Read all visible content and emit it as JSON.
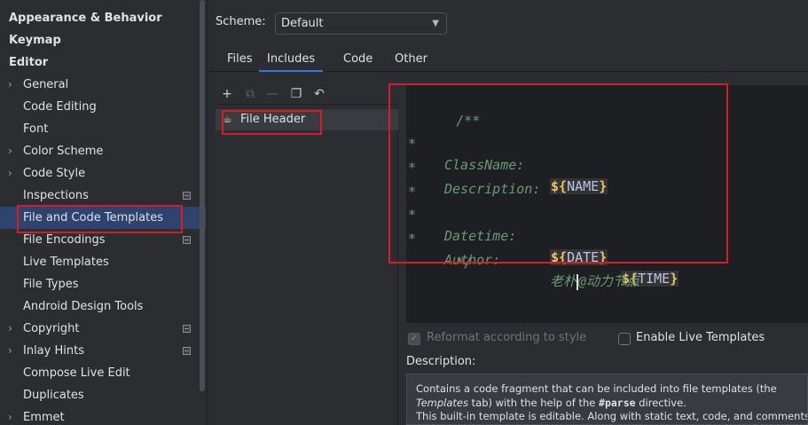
{
  "sidebar": {
    "items": [
      {
        "label": "Appearance & Behavior",
        "level": "top"
      },
      {
        "label": "Keymap",
        "level": "top"
      },
      {
        "label": "Editor",
        "level": "top"
      },
      {
        "label": "General",
        "level": "child",
        "arrow": "›"
      },
      {
        "label": "Code Editing",
        "level": "child"
      },
      {
        "label": "Font",
        "level": "child"
      },
      {
        "label": "Color Scheme",
        "level": "child",
        "arrow": "›"
      },
      {
        "label": "Code Style",
        "level": "child",
        "arrow": "›"
      },
      {
        "label": "Inspections",
        "level": "child",
        "badge": true
      },
      {
        "label": "File and Code Templates",
        "level": "child",
        "selected": true
      },
      {
        "label": "File Encodings",
        "level": "child",
        "badge": true
      },
      {
        "label": "Live Templates",
        "level": "child"
      },
      {
        "label": "File Types",
        "level": "child"
      },
      {
        "label": "Android Design Tools",
        "level": "child"
      },
      {
        "label": "Copyright",
        "level": "child",
        "arrow": "›",
        "badge": true
      },
      {
        "label": "Inlay Hints",
        "level": "child",
        "arrow": "›",
        "badge": true
      },
      {
        "label": "Compose Live Edit",
        "level": "child"
      },
      {
        "label": "Duplicates",
        "level": "child"
      },
      {
        "label": "Emmet",
        "level": "child",
        "arrow": "›"
      }
    ]
  },
  "scheme": {
    "label": "Scheme:",
    "value": "Default"
  },
  "tabs": [
    {
      "label": "Files"
    },
    {
      "label": "Includes",
      "active": true
    },
    {
      "label": "Code"
    },
    {
      "label": "Other"
    }
  ],
  "toolbar": {
    "icons": [
      "add-icon",
      "copy-template-icon",
      "remove-icon",
      "duplicate-icon",
      "reset-icon"
    ],
    "glyphs": [
      "+",
      "⧉",
      "—",
      "❐",
      "↶"
    ]
  },
  "template_list": {
    "items": [
      {
        "label": "File Header",
        "icon": "file-template-icon",
        "glyph": "☕"
      }
    ]
  },
  "editor": {
    "line1": "/**",
    "star": "*",
    "classname_key": "ClassName:",
    "name_var_prefix": "${",
    "name_var": "NAME",
    "var_suffix": "}",
    "description_key": "Description:",
    "datetime_key": "Datetime:",
    "date_var": "DATE",
    "time_var": "TIME",
    "author_key": "Author:",
    "author_value_before": "老朴",
    "author_value_after": "@动力节点",
    "last_line": "*/"
  },
  "options": {
    "reformat_label": "Reformat according to style",
    "reformat_checked": true,
    "live_templates_label": "Enable Live Templates",
    "live_templates_checked": false
  },
  "description": {
    "label": "Description:",
    "line1": "Contains a code fragment that can be included into file templates (the",
    "line2_italic": "Templates",
    "line2_mid": " tab) with the help of the ",
    "line2_bold": "#parse",
    "line2_end": " directive.",
    "line3": "This built-in template is editable. Along with static text, code, and comments,"
  },
  "colors": {
    "selection": "#2e436e",
    "highlight_border": "#d51d23",
    "accent": "#3574f0",
    "comment": "#6a9a76",
    "variable": "#e8c46a"
  }
}
